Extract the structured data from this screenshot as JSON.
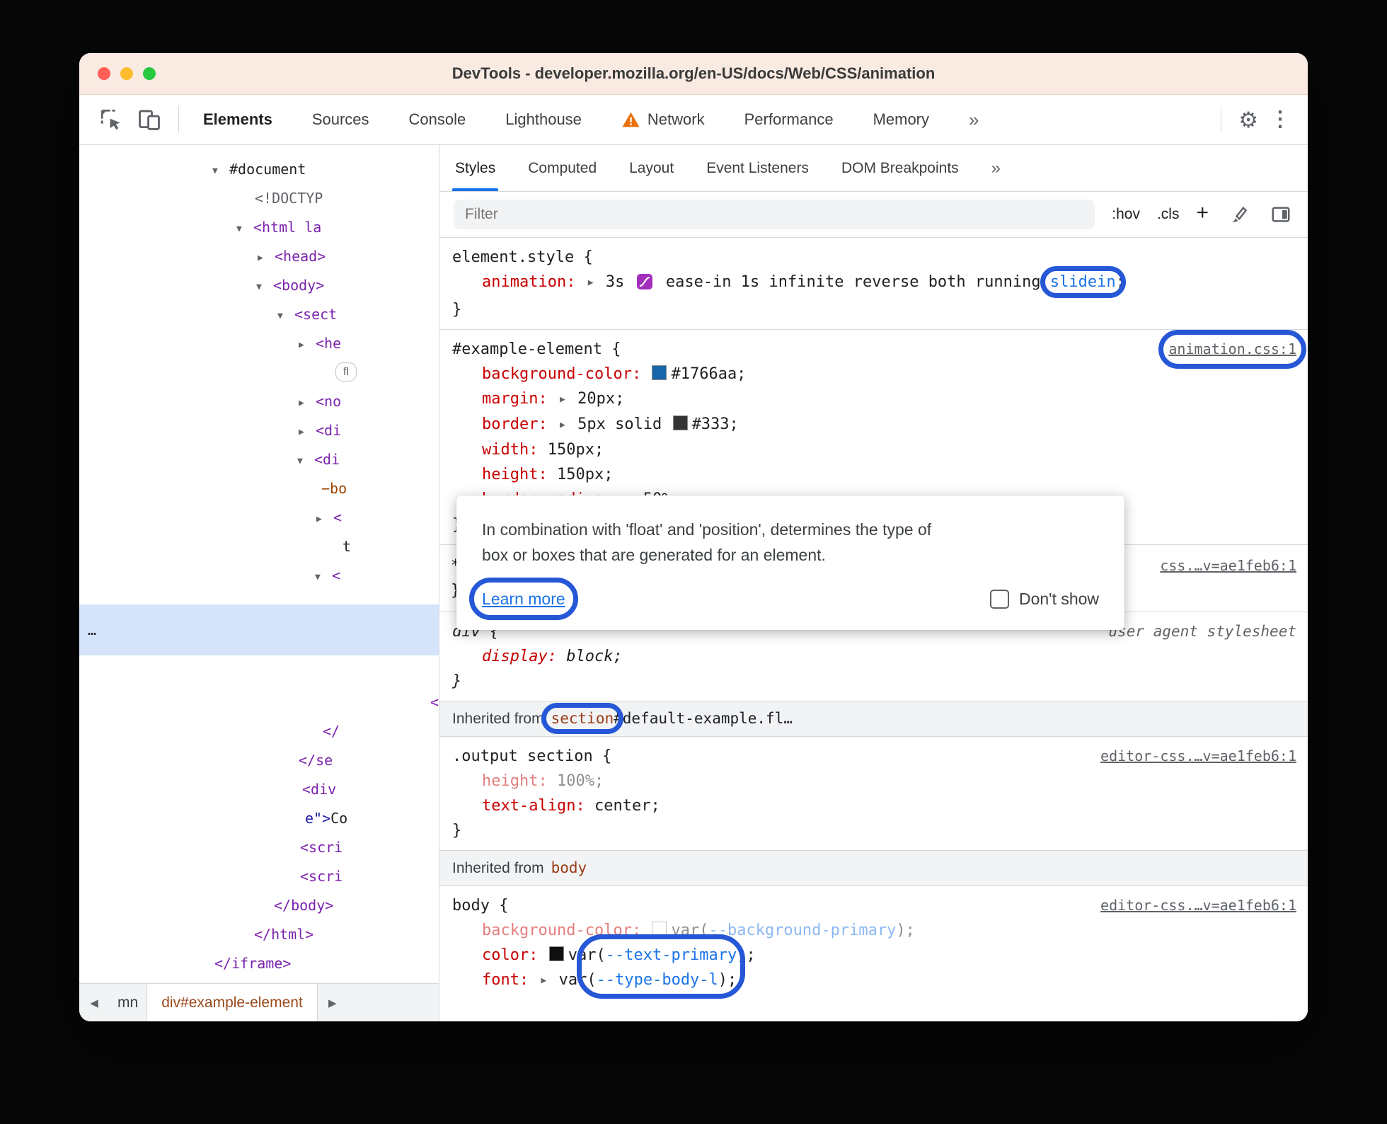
{
  "window_title": "DevTools - developer.mozilla.org/en-US/docs/Web/CSS/animation",
  "icons": {
    "overflow": "»",
    "gear": "⚙",
    "dots": "⋮",
    "expand": "▶",
    "prev": "◀",
    "next": "▶"
  },
  "main_tabs": [
    "Elements",
    "Sources",
    "Console",
    "Lighthouse",
    "Network",
    "Performance",
    "Memory"
  ],
  "styles_tabs": [
    "Styles",
    "Computed",
    "Layout",
    "Event Listeners",
    "DOM Breakpoints"
  ],
  "filter_bar": {
    "placeholder": "Filter",
    "hov": ":hov",
    "cls": ".cls",
    "plus": "+"
  },
  "syntax": {
    "close": "}",
    "semi": ";"
  },
  "rule_element_style": {
    "selector": "element.style {",
    "property": "animation:",
    "value_a": "3s",
    "value_b": "ease-in 1s infinite reverse both running",
    "keyframe": "slidein"
  },
  "rule_example": {
    "selector": "#example-element {",
    "link": "animation.css:1",
    "props": [
      {
        "name": "background-color:",
        "value": "#1766aa;"
      },
      {
        "name": "margin:",
        "value": "20px;"
      },
      {
        "name": "border:",
        "value_a": "5px solid",
        "value_b": "#333;"
      },
      {
        "name": "width:",
        "value": "150px;"
      },
      {
        "name": "height:",
        "value": "150px;"
      },
      {
        "name": "border-radius:",
        "value": "50%;"
      }
    ]
  },
  "tooltip": {
    "line1": "In combination with 'float' and 'position', determines the type of",
    "line2": "box or boxes that are generated for an element.",
    "learn_more": "Learn more",
    "dont_show": "Don't show"
  },
  "rule_star": {
    "selector": "*",
    "link": "css.…v=ae1feb6:1"
  },
  "rule_div": {
    "selector": "div {",
    "origin": "user agent stylesheet",
    "prop_name": "display:",
    "prop_value": "block;"
  },
  "inherited_section": {
    "label": "Inherited from",
    "node": "section",
    "node_rest": "#default-example.fl…"
  },
  "rule_output": {
    "selector": ".output section {",
    "link": "editor-css.…v=ae1feb6:1",
    "props": [
      {
        "name": "height:",
        "value": "100%;"
      },
      {
        "name": "text-align:",
        "value": "center;"
      }
    ]
  },
  "inherited_body": {
    "label": "Inherited from",
    "node": "body"
  },
  "rule_body": {
    "selector": "body {",
    "link": "editor-css.…v=ae1feb6:1",
    "prop_bg": {
      "name": "background-color:",
      "value_pre": "var",
      "open": "(",
      "var_name": "--background-primary",
      "close": ");"
    },
    "prop_color": {
      "name": "color:",
      "value_pre": "var",
      "open": "(",
      "var_name": "--text-primary",
      "close": ");"
    },
    "prop_font": {
      "name": "font:",
      "value_pre": "var",
      "open": "(",
      "var_name": "--type-body-l",
      "close": ");"
    }
  },
  "dom_tree": {
    "rows": [
      {
        "arrow": "▼",
        "text": "#document"
      },
      {
        "text": "<!DOCTYP"
      },
      {
        "arrow": "▼",
        "text": "<html la"
      },
      {
        "arrow": "▶",
        "text": "<head>"
      },
      {
        "arrow": "▼",
        "text": "<body>"
      },
      {
        "arrow": "▼",
        "text": "<sect"
      },
      {
        "arrow": "▶",
        "text": "<he"
      },
      {
        "badge": "fl"
      },
      {
        "arrow": "▶",
        "text": "<no"
      },
      {
        "arrow": "▶",
        "text": "<di"
      },
      {
        "arrow": "▼",
        "text": "<di"
      },
      {
        "text": "−bo"
      },
      {
        "arrow": "▶",
        "text": "<"
      },
      {
        "text": "t"
      },
      {
        "arrow": "▼",
        "text": "<"
      },
      {
        "text": "…"
      },
      {
        "text": "<"
      },
      {
        "text": "</"
      },
      {
        "text": "</se"
      },
      {
        "text": "<div"
      },
      {
        "val": "e\">",
        "text": "Co"
      },
      {
        "text": "<scri"
      },
      {
        "text": "<scri"
      },
      {
        "text": "</body>"
      },
      {
        "text": "</html>"
      },
      {
        "text": "</iframe>"
      }
    ]
  },
  "status_bar": {
    "crumb_partial": "mn",
    "crumb_active": "div#example-element"
  },
  "colors": {
    "annotation_blue": "#2557d6",
    "property_red": "#c80000",
    "tag_purple": "#7c22ad",
    "link_blue": "#1a73e8",
    "swatch_blue": "#1766aa",
    "swatch_dark": "#333333",
    "titlebar_bg": "#f9ebe2",
    "selected_row_bg": "#d6e4fb"
  }
}
